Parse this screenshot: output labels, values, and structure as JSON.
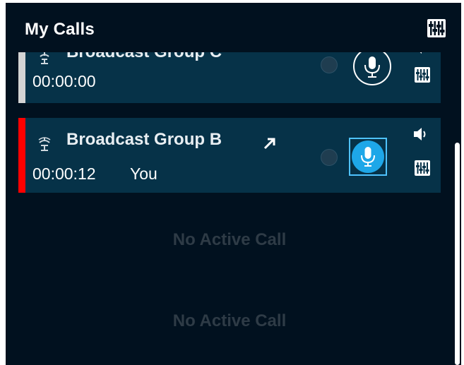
{
  "header": {
    "title": "My Calls",
    "settings_icon": "mixer-sliders-icon"
  },
  "calls": [
    {
      "name": "Broadcast Group C",
      "time": "00:00:00",
      "speaker": "",
      "accent_color": "#d4d4d4",
      "mic_state": "idle",
      "icons": [
        "broadcast-group-icon",
        "mic-icon",
        "speaker-icon",
        "mixer-sliders-icon"
      ]
    },
    {
      "name": "Broadcast Group B",
      "time": "00:00:12",
      "speaker": "You",
      "accent_color": "#ff0000",
      "mic_state": "active",
      "icons": [
        "broadcast-group-icon",
        "redirect-arrow-icon",
        "mic-icon",
        "speaker-icon",
        "mixer-sliders-icon"
      ]
    }
  ],
  "empty_slots": [
    {
      "label": "No Active Call"
    },
    {
      "label": "No Active Call"
    }
  ],
  "colors": {
    "panel_bg": "#01111f",
    "card_bg": "#063248",
    "active_mic": "#1ea7e8",
    "empty_text": "#2e3b46"
  }
}
